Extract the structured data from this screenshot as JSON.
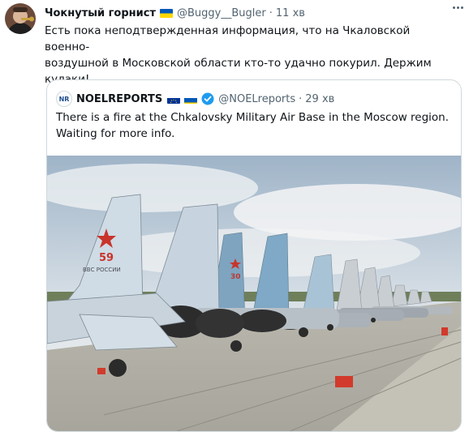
{
  "author": {
    "name": "Чокнутый горнист",
    "handle": "@Buggy__Bugler",
    "separator": "·",
    "time": "11 хв",
    "flag_icon": "ukraine-flag-icon"
  },
  "tweet": {
    "text": "Есть пока неподтвержденная информация, что на Чкаловской военно-\nвоздушной в Московской области кто-то удачно покурил. Держим\nкулаки!"
  },
  "quote": {
    "logo_text": "NR",
    "name": "NOELREPORTS",
    "handle": "@NOELreports",
    "separator": "·",
    "time": "29 хв",
    "text": "There is a fire at the Chkalovsky Military Air Base in the Moscow region.\nWaiting for more info.",
    "icons": [
      "eu-flag-icon",
      "ukraine-flag-icon",
      "verified-badge-icon"
    ],
    "image": {
      "description_icon": "jets-photo",
      "tail_numbers": [
        "59",
        "30"
      ],
      "tail_text": "ВВС РОССИИ"
    }
  },
  "colors": {
    "text": "#0f1419",
    "muted": "#536471",
    "border": "#cfd9de",
    "verified": "#1d9bf0",
    "ua_blue": "#0057b7",
    "ua_yellow": "#ffd700",
    "eu_blue": "#003399"
  }
}
